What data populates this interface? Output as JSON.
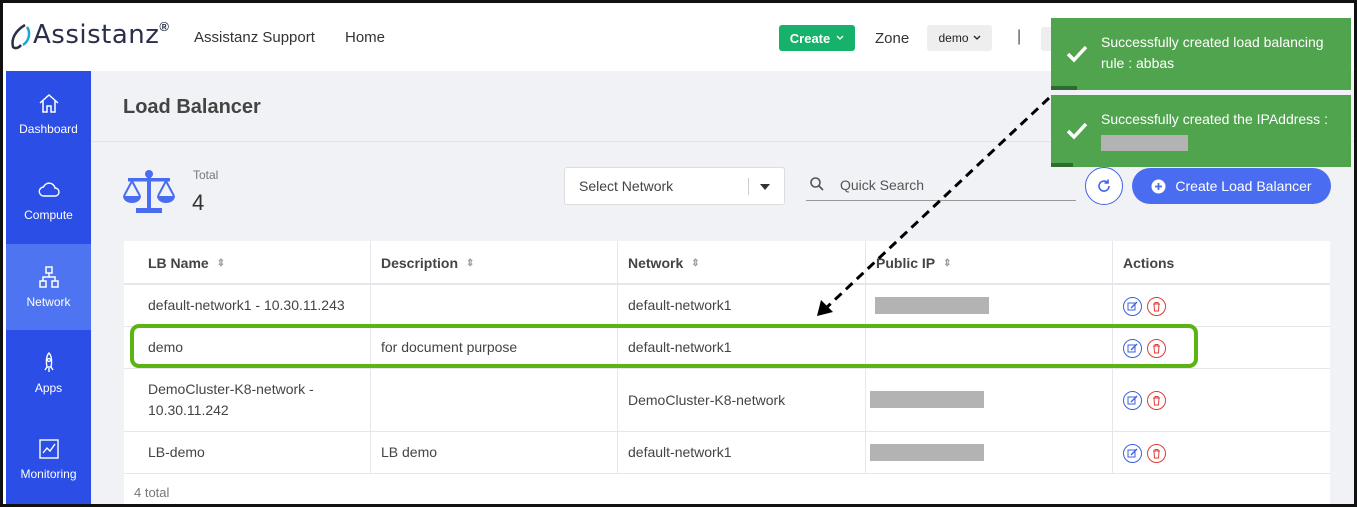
{
  "app": {
    "logo_text": "Assistanz",
    "logo_reg": "®",
    "nav": [
      "Assistanz Support",
      "Home"
    ],
    "create_label": "Create",
    "zone_label": "Zone",
    "zone_value": "demo",
    "divider": "|"
  },
  "sidebar": {
    "items": [
      {
        "label": "Dashboard",
        "icon": "home-icon"
      },
      {
        "label": "Compute",
        "icon": "cloud-icon"
      },
      {
        "label": "Network",
        "icon": "network-icon",
        "active": true
      },
      {
        "label": "Apps",
        "icon": "rocket-icon"
      },
      {
        "label": "Monitoring",
        "icon": "chart-icon"
      }
    ]
  },
  "page": {
    "title": "Load Balancer",
    "total_label": "Total",
    "total_value": "4",
    "network_select": "Select Network",
    "search_placeholder": "Quick Search",
    "create_button": "Create Load Balancer"
  },
  "table": {
    "columns": [
      "LB Name",
      "Description",
      "Network",
      "Public IP",
      "Actions"
    ],
    "rows": [
      {
        "name": "default-network1 - 10.30.11.243",
        "description": "",
        "network": "default-network1",
        "ip_redacted": true
      },
      {
        "name": "demo",
        "description": "for document purpose",
        "network": "default-network1",
        "ip_redacted": false
      },
      {
        "name": "DemoCluster-K8-network - 10.30.11.242",
        "description": "",
        "network": "DemoCluster-K8-network",
        "ip_redacted": true
      },
      {
        "name": "LB-demo",
        "description": "LB demo",
        "network": "default-network1",
        "ip_redacted": true
      }
    ],
    "footer": "4 total"
  },
  "toasts": [
    {
      "message": "Successfully created load balancing rule : abbas"
    },
    {
      "message": "Successfully created the IPAddress :"
    }
  ],
  "colors": {
    "sidebar": "#2a4ee6",
    "accent": "#4a6cf0",
    "success": "#51a44e",
    "create_green": "#16b16b",
    "highlight": "#5cb314"
  }
}
